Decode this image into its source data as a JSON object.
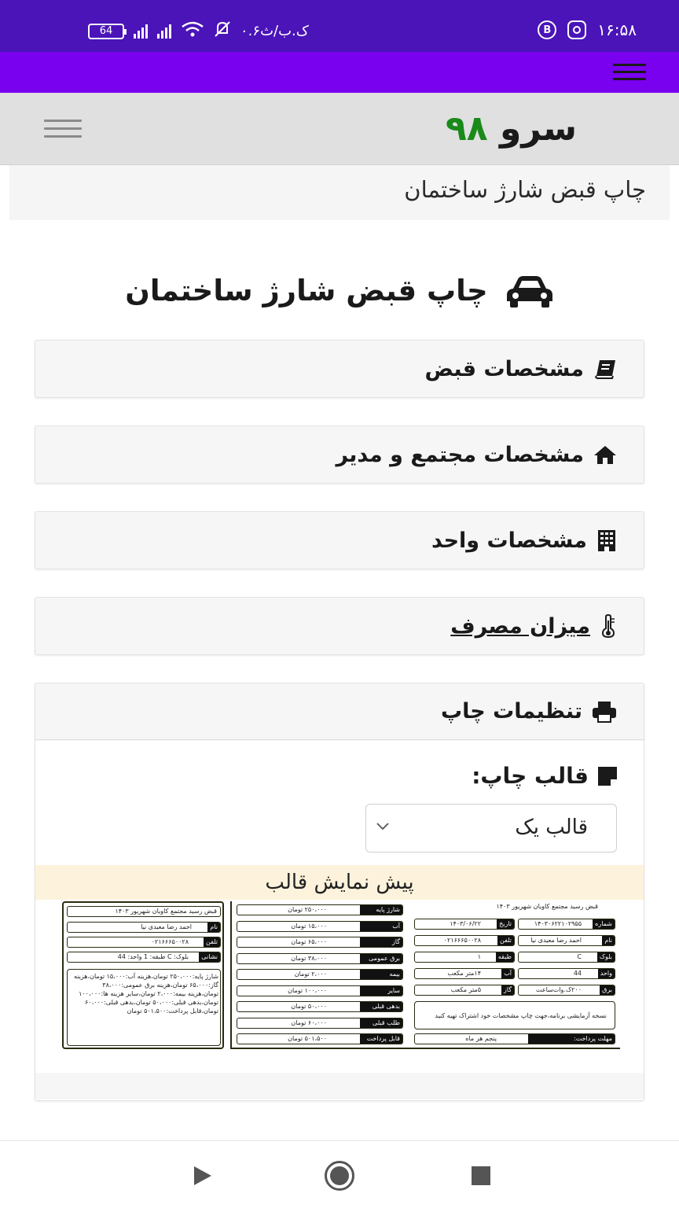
{
  "status_bar": {
    "time": "۱۶:۵۸",
    "network_speed": "۰.۶ک.ب/ث",
    "battery": "64"
  },
  "site": {
    "brand": "سرو",
    "brand_number": "۹۸"
  },
  "breadcrumb": "چاپ قبض شارژ ساختمان",
  "page_title": "چاپ قبض شارژ ساختمان",
  "accordion": [
    {
      "label": "مشخصات قبض",
      "icon": "book-icon"
    },
    {
      "label": "مشخصات مجتمع و مدیر",
      "icon": "home-icon"
    },
    {
      "label": "مشخصات واحد",
      "icon": "building-icon"
    },
    {
      "label": "میزان مصرف",
      "icon": "thermometer-icon"
    },
    {
      "label": "تنظیمات چاپ",
      "icon": "print-icon"
    }
  ],
  "print_settings": {
    "template_label": "قالب چاپ:",
    "template_selected": "قالب یک",
    "preview_title": "پیش نمایش قالب"
  },
  "receipt_preview": {
    "header": "قبض رسید مجتمع کاویان شهریور ۱۴۰۳",
    "stub_header": "قبض رسید مجتمع کاویان شهریور ۱۴۰۳",
    "stub_name": "احمد رضا معیدی نیا",
    "stub_phone": "۰۲۱۶۶۶۵۰۰۲۸",
    "stub_address": "بلوک: C طبقه: 1 واحد: 44",
    "stub_summary": "شارژ پایه:۲۵۰،۰۰۰ تومان،هزینه آب:۱۵،۰۰۰ تومان،هزینه گاز:۶۵،۰۰۰ تومان،هزینه برق عمومی:۳۸،۰۰۰ تومان،هزینه بیمه:۲،۰۰۰ تومان،سایر هزینه ها:۱۰۰،۰۰۰ تومان،بدهی قبلی:۵۰،۰۰۰ تومان،بدهی قبلی:۶۰،۰۰۰ تومان،قابل پرداخت:۵۰۱،۵۰۰ تومان",
    "left_fields": [
      {
        "k": "نام",
        "v": "احمد رضا معیدی نیا"
      },
      {
        "k": "تلفن",
        "v": "۰۲۱۶۶۶۵۰۰۲۸"
      },
      {
        "k": "نشانی",
        "v": "بلوک: C طبقه: 1 واحد: 44"
      }
    ],
    "amounts": [
      {
        "k": "شارژ پایه",
        "v": "۲۵۰،۰۰۰ تومان"
      },
      {
        "k": "آب",
        "v": "۱۵،۰۰۰ تومان"
      },
      {
        "k": "گاز",
        "v": "۶۵،۰۰۰ تومان"
      },
      {
        "k": "برق عمومی",
        "v": "۳۸،۰۰۰ تومان"
      },
      {
        "k": "بیمه",
        "v": "۲،۰۰۰ تومان"
      },
      {
        "k": "سایر",
        "v": "۱۰۰،۰۰۰ تومان"
      },
      {
        "k": "بدهی قبلی",
        "v": "۵۰،۰۰۰ تومان"
      },
      {
        "k": "طلب قبلی",
        "v": "۶۰،۰۰۰ تومان"
      },
      {
        "k": "قابل پرداخت",
        "v": "۵۰۱،۵۰۰ تومان"
      }
    ],
    "info_fields": [
      {
        "k": "شماره",
        "v": "۱۴۰۳۰۶۲۲۱۰۲۹۵۵"
      },
      {
        "k": "تاریخ",
        "v": "۱۴۰۳/۰۶/۲۲"
      },
      {
        "k": "نام",
        "v": "احمد رضا معیدی نیا"
      },
      {
        "k": "تلفن",
        "v": "۰۲۱۶۶۶۵۰۰۲۸"
      },
      {
        "k": "بلوک",
        "v": "C"
      },
      {
        "k": "طبقه",
        "v": "۱"
      },
      {
        "k": "واحد",
        "v": "44"
      },
      {
        "k": "آب",
        "v": "۱۴متر مکعب"
      },
      {
        "k": "برق",
        "v": "۲۰۰ک.وات‌ساعت"
      },
      {
        "k": "گاز",
        "v": "۵متر مکعب"
      }
    ],
    "note": "نسخه آزمایشی برنامه،جهت چاپ مشخصات خود اشتراک تهیه کنید",
    "deadline_label": "مهلت پرداخت:",
    "deadline_value": "پنجم هر ماه"
  },
  "colors": {
    "status_bar": "#4a14b8",
    "app_bar": "#7a00f0",
    "brand_green": "#1a8a1a",
    "preview_bar": "#fdf3dc"
  }
}
